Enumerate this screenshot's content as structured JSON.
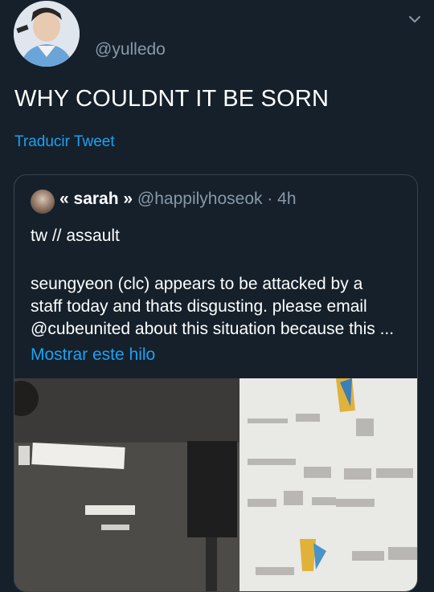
{
  "tweet": {
    "handle": "@yulledo",
    "text": "WHY COULDNT IT BE SORN",
    "translate_label": "Traducir Tweet"
  },
  "quote": {
    "name": "« sarah »",
    "handle": "@happilyhoseok",
    "time": "· 4h",
    "line1": "tw // assault",
    "body_lines": [
      "seungyeon (clc) appears to be attacked by a",
      "staff today and thats disgusting. please email",
      "@cubeunited about this situation because this ..."
    ],
    "show_thread": "Mostrar este hilo"
  },
  "icons": {
    "menu": "chevron-down-icon"
  },
  "colors": {
    "background": "#15202b",
    "accent": "#1da1f2",
    "secondary_text": "#8899a6",
    "border": "#38444d"
  }
}
